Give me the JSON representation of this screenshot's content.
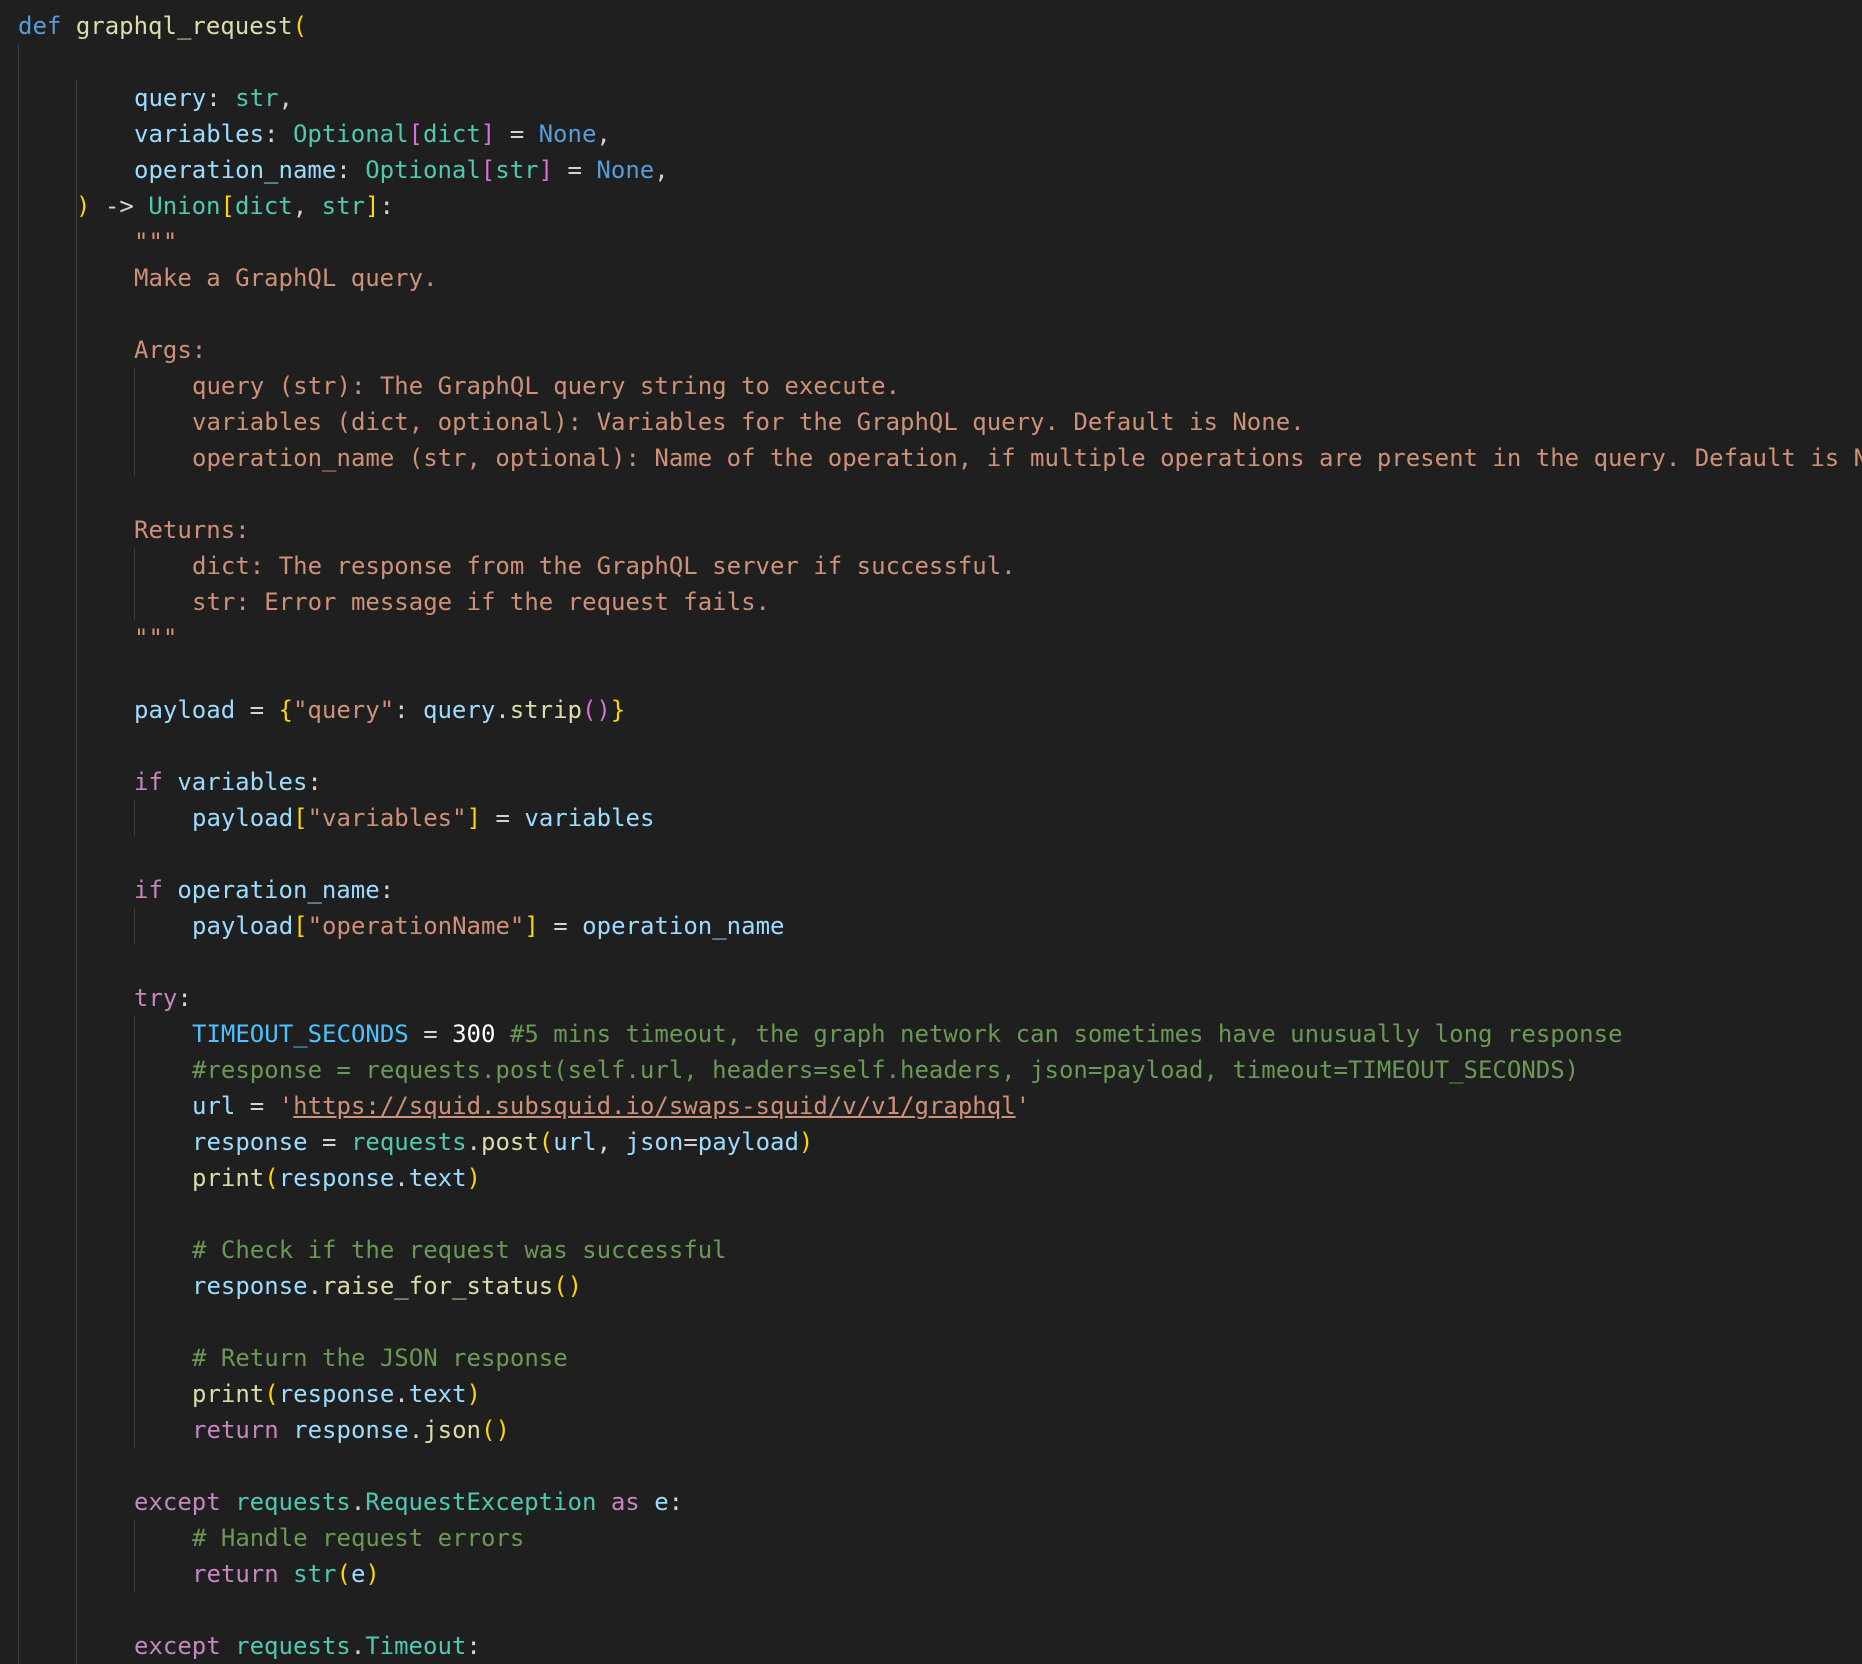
{
  "editor": {
    "language": "python",
    "theme_colors": {
      "background": "#1f1f1f",
      "keyword_blue": "#569cd6",
      "keyword_purple": "#c586c0",
      "function": "#dcdcaa",
      "variable": "#9cdcfe",
      "constant": "#4fc1ff",
      "type": "#4ec9b0",
      "string": "#ce9178",
      "comment": "#6a9955",
      "bracket_gold": "#ffd700",
      "bracket_orchid": "#da70d6"
    },
    "lines": [
      {
        "indent": 0,
        "tokens": [
          [
            "def",
            "kw-blue"
          ],
          [
            " ",
            "op"
          ],
          [
            "graphql_request",
            "fn"
          ],
          [
            "(",
            "br1"
          ]
        ]
      },
      {
        "indent": 0,
        "tokens": []
      },
      {
        "indent": 2,
        "tokens": [
          [
            "query",
            "var"
          ],
          [
            ": ",
            "op"
          ],
          [
            "str",
            "type"
          ],
          [
            ",",
            "op"
          ]
        ]
      },
      {
        "indent": 2,
        "tokens": [
          [
            "variables",
            "var"
          ],
          [
            ": ",
            "op"
          ],
          [
            "Optional",
            "type"
          ],
          [
            "[",
            "br2"
          ],
          [
            "dict",
            "type"
          ],
          [
            "]",
            "br2"
          ],
          [
            " = ",
            "op"
          ],
          [
            "None",
            "kw-blue"
          ],
          [
            ",",
            "op"
          ]
        ]
      },
      {
        "indent": 2,
        "tokens": [
          [
            "operation_name",
            "var"
          ],
          [
            ": ",
            "op"
          ],
          [
            "Optional",
            "type"
          ],
          [
            "[",
            "br2"
          ],
          [
            "str",
            "type"
          ],
          [
            "]",
            "br2"
          ],
          [
            " = ",
            "op"
          ],
          [
            "None",
            "kw-blue"
          ],
          [
            ",",
            "op"
          ]
        ]
      },
      {
        "indent": 1,
        "tokens": [
          [
            ")",
            "br1"
          ],
          [
            " -> ",
            "op"
          ],
          [
            "Union",
            "type"
          ],
          [
            "[",
            "br1"
          ],
          [
            "dict",
            "type"
          ],
          [
            ", ",
            "op"
          ],
          [
            "str",
            "type"
          ],
          [
            "]",
            "br1"
          ],
          [
            ":",
            "op"
          ]
        ]
      },
      {
        "indent": 2,
        "tokens": [
          [
            "\"\"\"",
            "doc"
          ]
        ]
      },
      {
        "indent": 2,
        "tokens": [
          [
            "Make a GraphQL query.",
            "doc"
          ]
        ]
      },
      {
        "indent": 0,
        "tokens": []
      },
      {
        "indent": 2,
        "tokens": [
          [
            "Args:",
            "doc"
          ]
        ]
      },
      {
        "indent": 3,
        "tokens": [
          [
            "query (str): The GraphQL query string to execute.",
            "doc"
          ]
        ]
      },
      {
        "indent": 3,
        "tokens": [
          [
            "variables (dict, optional): Variables for the GraphQL query. Default is None.",
            "doc"
          ]
        ]
      },
      {
        "indent": 3,
        "tokens": [
          [
            "operation_name (str, optional): Name of the operation, if multiple operations are present in the query. Default is N",
            "doc"
          ]
        ]
      },
      {
        "indent": 0,
        "tokens": []
      },
      {
        "indent": 2,
        "tokens": [
          [
            "Returns:",
            "doc"
          ]
        ]
      },
      {
        "indent": 3,
        "tokens": [
          [
            "dict: The response from the GraphQL server if successful.",
            "doc"
          ]
        ]
      },
      {
        "indent": 3,
        "tokens": [
          [
            "str: Error message if the request fails.",
            "doc"
          ]
        ]
      },
      {
        "indent": 2,
        "tokens": [
          [
            "\"\"\"",
            "doc"
          ]
        ]
      },
      {
        "indent": 0,
        "tokens": []
      },
      {
        "indent": 2,
        "tokens": [
          [
            "payload",
            "var"
          ],
          [
            " = ",
            "op"
          ],
          [
            "{",
            "br1"
          ],
          [
            "\"query\"",
            "str"
          ],
          [
            ": ",
            "op"
          ],
          [
            "query",
            "var"
          ],
          [
            ".",
            "op"
          ],
          [
            "strip",
            "fn"
          ],
          [
            "()",
            "br2"
          ],
          [
            "}",
            "br1"
          ]
        ]
      },
      {
        "indent": 0,
        "tokens": []
      },
      {
        "indent": 2,
        "tokens": [
          [
            "if",
            "kw-purple"
          ],
          [
            " ",
            "op"
          ],
          [
            "variables",
            "var"
          ],
          [
            ":",
            "op"
          ]
        ]
      },
      {
        "indent": 3,
        "tokens": [
          [
            "payload",
            "var"
          ],
          [
            "[",
            "br1"
          ],
          [
            "\"variables\"",
            "str"
          ],
          [
            "]",
            "br1"
          ],
          [
            " = ",
            "op"
          ],
          [
            "variables",
            "var"
          ]
        ]
      },
      {
        "indent": 0,
        "tokens": []
      },
      {
        "indent": 2,
        "tokens": [
          [
            "if",
            "kw-purple"
          ],
          [
            " ",
            "op"
          ],
          [
            "operation_name",
            "var"
          ],
          [
            ":",
            "op"
          ]
        ]
      },
      {
        "indent": 3,
        "tokens": [
          [
            "payload",
            "var"
          ],
          [
            "[",
            "br1"
          ],
          [
            "\"operationName\"",
            "str"
          ],
          [
            "]",
            "br1"
          ],
          [
            " = ",
            "op"
          ],
          [
            "operation_name",
            "var"
          ]
        ]
      },
      {
        "indent": 0,
        "tokens": []
      },
      {
        "indent": 2,
        "tokens": [
          [
            "try",
            "kw-purple"
          ],
          [
            ":",
            "op"
          ]
        ]
      },
      {
        "indent": 3,
        "tokens": [
          [
            "TIMEOUT_SECONDS",
            "const"
          ],
          [
            " = ",
            "op"
          ],
          [
            "300",
            "num-bright"
          ],
          [
            " ",
            "op"
          ],
          [
            "#5 mins timeout, the graph network can sometimes have unusually long response",
            "comment"
          ]
        ]
      },
      {
        "indent": 3,
        "tokens": [
          [
            "#response = requests.post(self.url, headers=self.headers, json=payload, timeout=TIMEOUT_SECONDS)",
            "comment"
          ]
        ]
      },
      {
        "indent": 3,
        "tokens": [
          [
            "url",
            "var"
          ],
          [
            " = ",
            "op"
          ],
          [
            "'",
            "str"
          ],
          [
            "https://squid.subsquid.io/swaps-squid/v/v1/graphql",
            "link"
          ],
          [
            "'",
            "str"
          ]
        ]
      },
      {
        "indent": 3,
        "tokens": [
          [
            "response",
            "var"
          ],
          [
            " = ",
            "op"
          ],
          [
            "requests",
            "type"
          ],
          [
            ".",
            "op"
          ],
          [
            "post",
            "fn"
          ],
          [
            "(",
            "br1"
          ],
          [
            "url",
            "var"
          ],
          [
            ", ",
            "op"
          ],
          [
            "json",
            "var"
          ],
          [
            "=",
            "op"
          ],
          [
            "payload",
            "var"
          ],
          [
            ")",
            "br1"
          ]
        ]
      },
      {
        "indent": 3,
        "tokens": [
          [
            "print",
            "fn"
          ],
          [
            "(",
            "br1"
          ],
          [
            "response",
            "var"
          ],
          [
            ".",
            "op"
          ],
          [
            "text",
            "var"
          ],
          [
            ")",
            "br1"
          ]
        ]
      },
      {
        "indent": 0,
        "tokens": []
      },
      {
        "indent": 3,
        "tokens": [
          [
            "# Check if the request was successful",
            "comment"
          ]
        ]
      },
      {
        "indent": 3,
        "tokens": [
          [
            "response",
            "var"
          ],
          [
            ".",
            "op"
          ],
          [
            "raise_for_status",
            "fn"
          ],
          [
            "()",
            "br1"
          ]
        ]
      },
      {
        "indent": 0,
        "tokens": []
      },
      {
        "indent": 3,
        "tokens": [
          [
            "# Return the JSON response",
            "comment"
          ]
        ]
      },
      {
        "indent": 3,
        "tokens": [
          [
            "print",
            "fn"
          ],
          [
            "(",
            "br1"
          ],
          [
            "response",
            "var"
          ],
          [
            ".",
            "op"
          ],
          [
            "text",
            "var"
          ],
          [
            ")",
            "br1"
          ]
        ]
      },
      {
        "indent": 3,
        "tokens": [
          [
            "return",
            "kw-purple"
          ],
          [
            " ",
            "op"
          ],
          [
            "response",
            "var"
          ],
          [
            ".",
            "op"
          ],
          [
            "json",
            "fn"
          ],
          [
            "()",
            "br1"
          ]
        ]
      },
      {
        "indent": 0,
        "tokens": []
      },
      {
        "indent": 2,
        "tokens": [
          [
            "except",
            "kw-purple"
          ],
          [
            " ",
            "op"
          ],
          [
            "requests",
            "type"
          ],
          [
            ".",
            "op"
          ],
          [
            "RequestException",
            "type"
          ],
          [
            " ",
            "op"
          ],
          [
            "as",
            "kw-purple"
          ],
          [
            " ",
            "op"
          ],
          [
            "e",
            "var"
          ],
          [
            ":",
            "op"
          ]
        ]
      },
      {
        "indent": 3,
        "tokens": [
          [
            "# Handle request errors",
            "comment"
          ]
        ]
      },
      {
        "indent": 3,
        "tokens": [
          [
            "return",
            "kw-purple"
          ],
          [
            " ",
            "op"
          ],
          [
            "str",
            "type"
          ],
          [
            "(",
            "br1"
          ],
          [
            "e",
            "var"
          ],
          [
            ")",
            "br1"
          ]
        ]
      },
      {
        "indent": 0,
        "tokens": []
      },
      {
        "indent": 2,
        "tokens": [
          [
            "except",
            "kw-purple"
          ],
          [
            " ",
            "op"
          ],
          [
            "requests",
            "type"
          ],
          [
            ".",
            "op"
          ],
          [
            "Timeout",
            "type"
          ],
          [
            ":",
            "op"
          ]
        ]
      }
    ]
  }
}
